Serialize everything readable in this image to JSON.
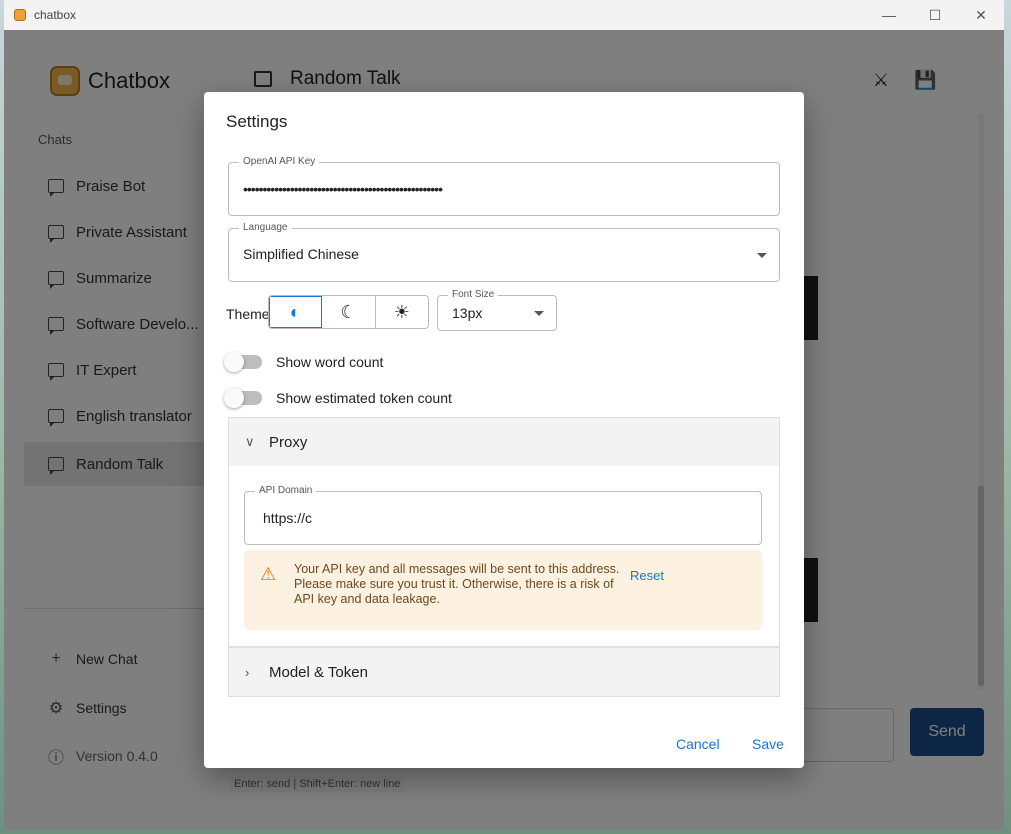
{
  "window": {
    "title": "chatbox",
    "controls": [
      "minimize-icon",
      "maximize-icon",
      "close-icon"
    ]
  },
  "sidebar": {
    "brand": "Chatbox",
    "chats_label": "Chats",
    "items": [
      {
        "label": "Praise Bot"
      },
      {
        "label": "Private Assistant"
      },
      {
        "label": "Summarize"
      },
      {
        "label": "Software Develo..."
      },
      {
        "label": "IT Expert"
      },
      {
        "label": "English translator"
      },
      {
        "label": "Random Talk",
        "active": true
      }
    ],
    "new_chat": "New Chat",
    "settings": "Settings",
    "version": "Version 0.4.0"
  },
  "main": {
    "title": "Random Talk",
    "send_label": "Send",
    "input_hint": "Enter: send | Shift+Enter: new line"
  },
  "dialog": {
    "title": "Settings",
    "api_key": {
      "label": "OpenAI API Key",
      "value": "•••••••••••••••••••••••••••••••••••••••••••••••••••"
    },
    "language": {
      "label": "Language",
      "value": "Simplified Chinese"
    },
    "theme": {
      "label": "Theme",
      "options": [
        "auto-theme-icon",
        "dark-theme-icon",
        "light-theme-icon"
      ],
      "selected": 0
    },
    "font_size": {
      "label": "Font Size",
      "value": "13px"
    },
    "toggles": {
      "word_count": "Show word count",
      "token_count": "Show estimated token count"
    },
    "proxy": {
      "title": "Proxy",
      "api_domain": {
        "label": "API Domain",
        "value": "https://c"
      },
      "warning": "Your API key and all messages will be sent to this address. Please make sure you trust it. Otherwise, there is a risk of API key and data leakage.",
      "reset": "Reset"
    },
    "model_token": {
      "title": "Model & Token"
    },
    "cancel": "Cancel",
    "save": "Save"
  },
  "colors": {
    "accent": "#1976d2",
    "send_button": "#1d4c8a",
    "warning_bg": "#fdf1e2"
  }
}
